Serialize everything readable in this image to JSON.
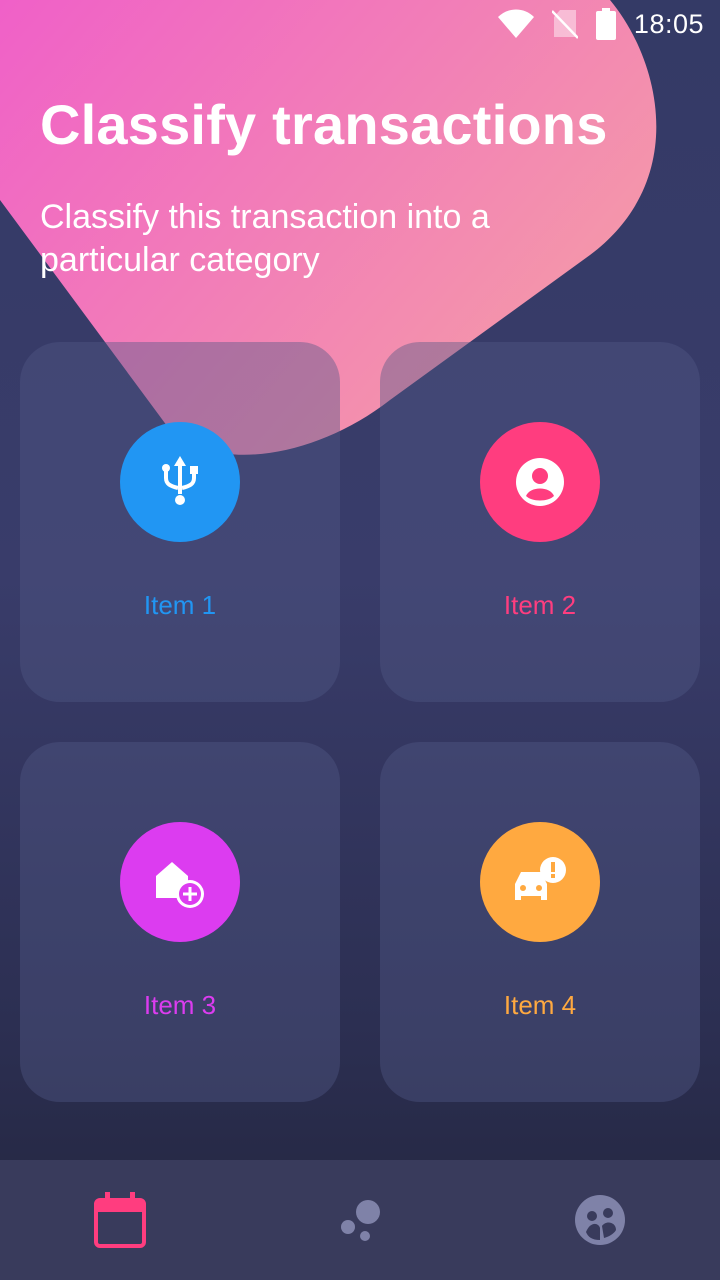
{
  "status_bar": {
    "time": "18:05",
    "icons": [
      "wifi-icon",
      "no-sim-icon",
      "battery-icon"
    ]
  },
  "header": {
    "title": "Classify transactions",
    "subtitle": "Classify this transaction into a particular category"
  },
  "items": [
    {
      "label": "Item 1",
      "icon": "usb-icon",
      "color": "#2196f3"
    },
    {
      "label": "Item 2",
      "icon": "account-circle-icon",
      "color": "#ff3d7f"
    },
    {
      "label": "Item 3",
      "icon": "home-add-icon",
      "color": "#dc3cf0"
    },
    {
      "label": "Item 4",
      "icon": "car-alert-icon",
      "color": "#ffa940"
    }
  ],
  "bottom_nav": {
    "items": [
      {
        "icon": "calendar-icon",
        "active": true,
        "color": "#ff3d7f"
      },
      {
        "icon": "bubbles-icon",
        "active": false,
        "color": "#7f82a8"
      },
      {
        "icon": "face-icon",
        "active": false,
        "color": "#7f82a8"
      }
    ]
  },
  "colors": {
    "background": "#343a66",
    "blob_start": "#f060c8",
    "blob_end": "#f49aa8",
    "card": "#474b78",
    "nav_background": "#393b5c"
  }
}
